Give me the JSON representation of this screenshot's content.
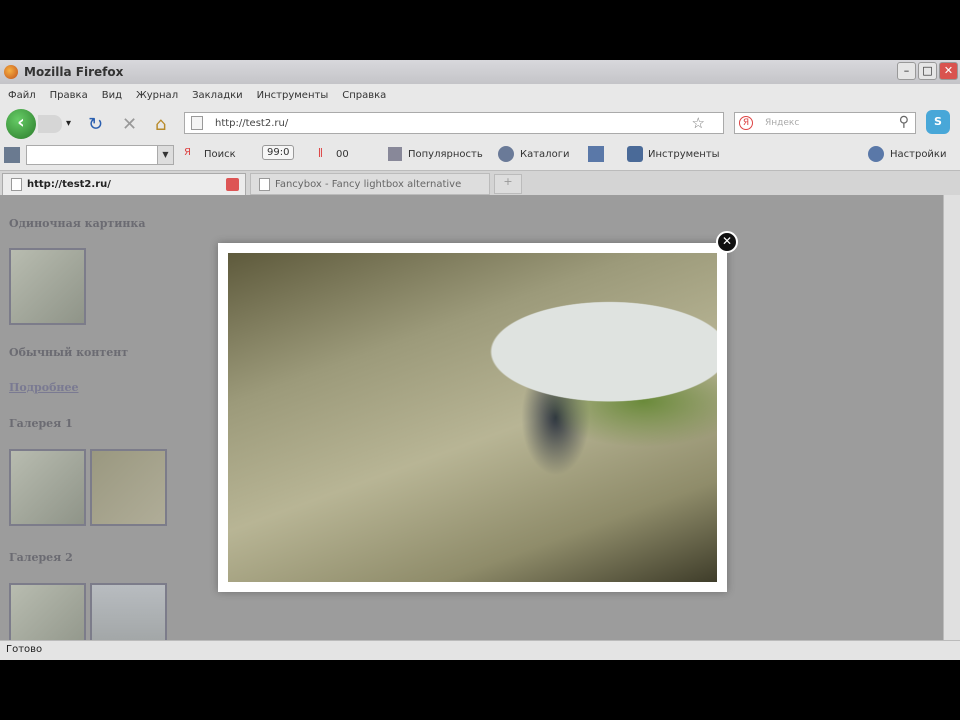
{
  "window": {
    "title": "Mozilla Firefox"
  },
  "menu": [
    "Файл",
    "Правка",
    "Вид",
    "Журнал",
    "Закладки",
    "Инструменты",
    "Справка"
  ],
  "nav": {
    "url": "http://test2.ru/",
    "search_placeholder": "Яндекс"
  },
  "yabar": {
    "search": "Поиск",
    "counter": "99:0",
    "count2": "00",
    "popularity": "Популярность",
    "catalogs": "Каталоги",
    "tools": "Инструменты",
    "settings": "Настройки"
  },
  "tabs": [
    {
      "label": "http://test2.ru/"
    },
    {
      "label": "Fancybox - Fancy lightbox alternative"
    }
  ],
  "page": {
    "single": "Одиночная картинка",
    "content": "Обычный контент",
    "more": "Подробнее",
    "gallery1": "Галерея 1",
    "gallery2": "Галерея 2"
  },
  "status": "Готово"
}
